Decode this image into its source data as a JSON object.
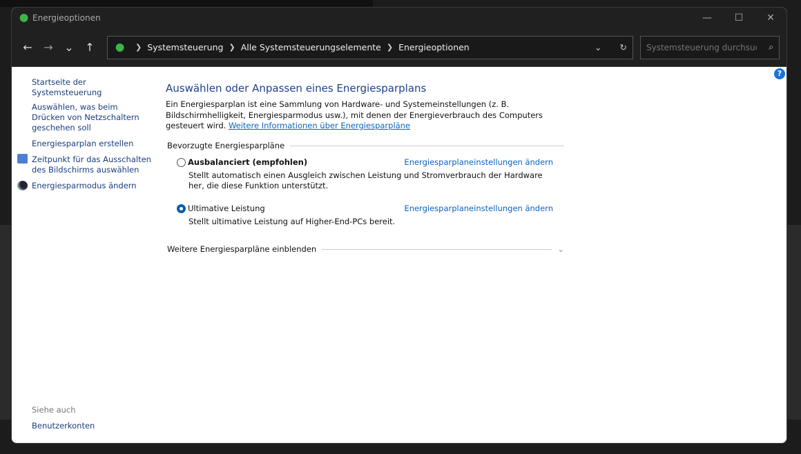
{
  "window": {
    "title": "Energieoptionen",
    "minimize": "—",
    "maximize": "☐",
    "close": "✕"
  },
  "nav": {
    "back": "←",
    "forward": "→",
    "recent": "⌄",
    "up": "↑",
    "breadcrumb": [
      "Systemsteuerung",
      "Alle Systemsteuerungselemente",
      "Energieoptionen"
    ],
    "dropdown": "⌄",
    "refresh": "↻",
    "search_placeholder": "Systemsteuerung durchsuc...",
    "search_icon": "⌕"
  },
  "sidebar": {
    "items": [
      {
        "label": "Startseite der Systemsteuerung"
      },
      {
        "label": "Auswählen, was beim Drücken von Netzschaltern geschehen soll"
      },
      {
        "label": "Energiesparplan erstellen"
      },
      {
        "label": "Zeitpunkt für das Ausschalten des Bildschirms auswählen",
        "icon": "clock-monitor-icon"
      },
      {
        "label": "Energiesparmodus ändern",
        "icon": "moon-icon"
      }
    ],
    "see_also": "Siehe auch",
    "see_also_items": [
      "Benutzerkonten"
    ]
  },
  "main": {
    "title": "Auswählen oder Anpassen eines Energiesparplans",
    "description": "Ein Energiesparplan ist eine Sammlung von Hardware- und Systemeinstellungen (z. B. Bildschirmhelligkeit, Energiesparmodus usw.), mit denen der Energieverbrauch des Computers gesteuert wird. ",
    "more_link": "Weitere Informationen über Energiesparpläne",
    "preferred_header": "Bevorzugte Energiesparpläne",
    "plans": [
      {
        "name": "Ausbalanciert (empfohlen)",
        "selected": false,
        "link": "Energiesparplaneinstellungen ändern",
        "description": "Stellt automatisch einen Ausgleich zwischen Leistung und Stromverbrauch der Hardware her, die diese Funktion unterstützt."
      },
      {
        "name": "Ultimative Leistung",
        "selected": true,
        "link": "Energiesparplaneinstellungen ändern",
        "description": "Stellt ultimative Leistung auf Higher-End-PCs bereit."
      }
    ],
    "more_plans": "Weitere Energiesparpläne einblenden",
    "expand": "⌄",
    "help": "?"
  },
  "colors": {
    "accent": "#0b5cad",
    "link": "#0b64c0",
    "title": "#1e3f8a"
  }
}
